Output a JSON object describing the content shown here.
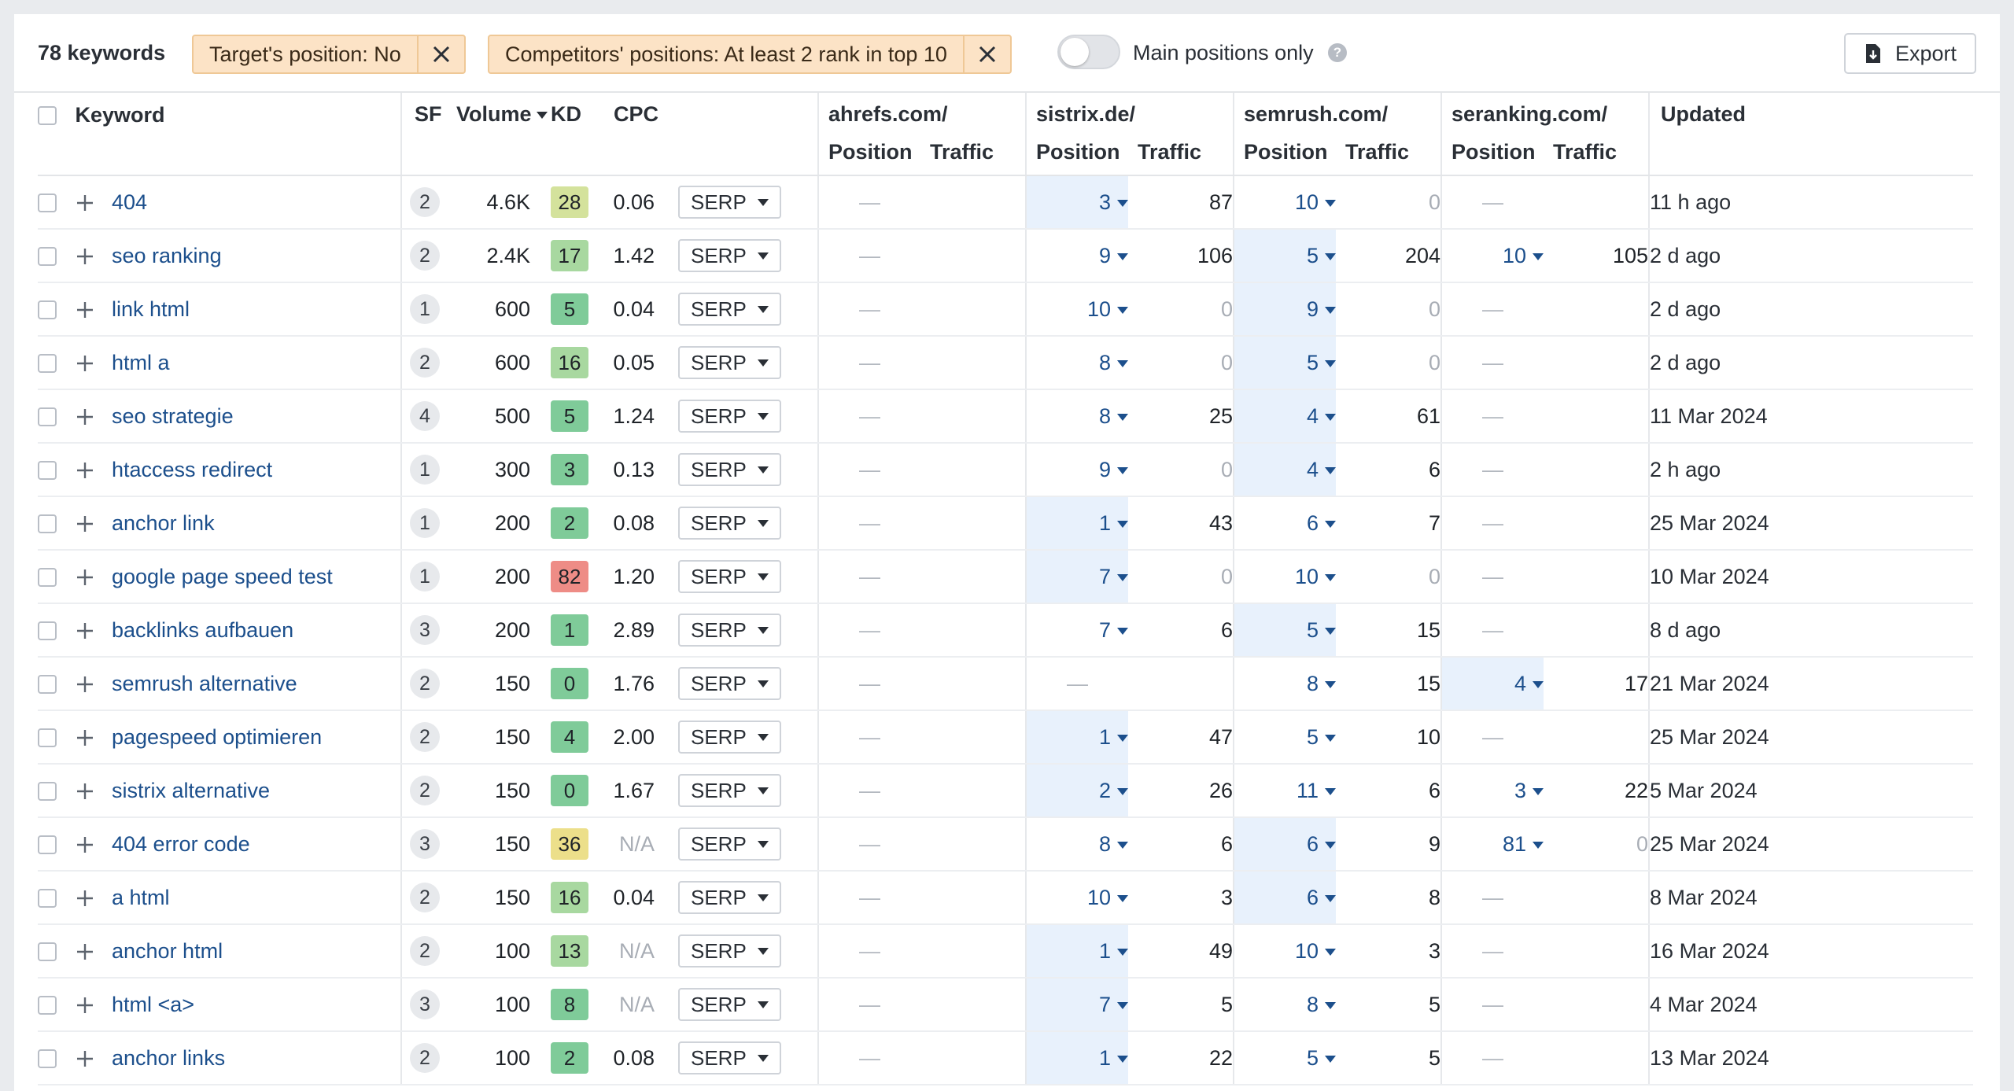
{
  "filters": {
    "keyword_count": "78 keywords",
    "chips": [
      {
        "label": "Target's position: No"
      },
      {
        "label": "Competitors' positions: At least 2 rank in top 10"
      }
    ],
    "toggle_label": "Main positions only",
    "toggle_on": false,
    "help_glyph": "?",
    "export_label": "Export"
  },
  "table": {
    "headers": {
      "keyword": "Keyword",
      "sf": "SF",
      "volume": "Volume",
      "kd": "KD",
      "cpc": "CPC",
      "updated": "Updated",
      "position": "Position",
      "traffic": "Traffic"
    },
    "competitors": [
      "ahrefs.com/",
      "sistrix.de/",
      "semrush.com/",
      "seranking.com/"
    ],
    "serp_label": "SERP",
    "dash": "—",
    "colors": {
      "kd_green_dark": "#7fcb99",
      "kd_green_mid": "#a8d8a0",
      "kd_yellow_green": "#d4e29c",
      "kd_yellow": "#ecdf8a",
      "kd_red": "#ee8c86",
      "highlight": "#e8f1fc",
      "link": "#1c4f8c"
    },
    "rows": [
      {
        "keyword": "404",
        "sf": "2",
        "volume": "4.6K",
        "kd": "28",
        "kd_color": "#d4e29c",
        "cpc": "0.06",
        "c": [
          {
            "p": "—",
            "t": ""
          },
          {
            "p": "3",
            "t": "87",
            "hl": true
          },
          {
            "p": "10",
            "t": "0"
          },
          {
            "p": "—",
            "t": ""
          }
        ],
        "updated": "11 h ago"
      },
      {
        "keyword": "seo ranking",
        "sf": "2",
        "volume": "2.4K",
        "kd": "17",
        "kd_color": "#a8d8a0",
        "cpc": "1.42",
        "c": [
          {
            "p": "—",
            "t": ""
          },
          {
            "p": "9",
            "t": "106"
          },
          {
            "p": "5",
            "t": "204",
            "hl": true
          },
          {
            "p": "10",
            "t": "105"
          }
        ],
        "updated": "2 d ago"
      },
      {
        "keyword": "link html",
        "sf": "1",
        "volume": "600",
        "kd": "5",
        "kd_color": "#7fcb99",
        "cpc": "0.04",
        "c": [
          {
            "p": "—",
            "t": ""
          },
          {
            "p": "10",
            "t": "0"
          },
          {
            "p": "9",
            "t": "0",
            "hl": true
          },
          {
            "p": "—",
            "t": ""
          }
        ],
        "updated": "2 d ago"
      },
      {
        "keyword": "html a",
        "sf": "2",
        "volume": "600",
        "kd": "16",
        "kd_color": "#a8d8a0",
        "cpc": "0.05",
        "c": [
          {
            "p": "—",
            "t": ""
          },
          {
            "p": "8",
            "t": "0"
          },
          {
            "p": "5",
            "t": "0",
            "hl": true
          },
          {
            "p": "—",
            "t": ""
          }
        ],
        "updated": "2 d ago"
      },
      {
        "keyword": "seo strategie",
        "sf": "4",
        "volume": "500",
        "kd": "5",
        "kd_color": "#7fcb99",
        "cpc": "1.24",
        "c": [
          {
            "p": "—",
            "t": ""
          },
          {
            "p": "8",
            "t": "25"
          },
          {
            "p": "4",
            "t": "61",
            "hl": true
          },
          {
            "p": "—",
            "t": ""
          }
        ],
        "updated": "11 Mar 2024"
      },
      {
        "keyword": "htaccess redirect",
        "sf": "1",
        "volume": "300",
        "kd": "3",
        "kd_color": "#7fcb99",
        "cpc": "0.13",
        "c": [
          {
            "p": "—",
            "t": ""
          },
          {
            "p": "9",
            "t": "0"
          },
          {
            "p": "4",
            "t": "6",
            "hl": true
          },
          {
            "p": "—",
            "t": ""
          }
        ],
        "updated": "2 h ago"
      },
      {
        "keyword": "anchor link",
        "sf": "1",
        "volume": "200",
        "kd": "2",
        "kd_color": "#7fcb99",
        "cpc": "0.08",
        "c": [
          {
            "p": "—",
            "t": ""
          },
          {
            "p": "1",
            "t": "43",
            "hl": true
          },
          {
            "p": "6",
            "t": "7"
          },
          {
            "p": "—",
            "t": ""
          }
        ],
        "updated": "25 Mar 2024"
      },
      {
        "keyword": "google page speed test",
        "sf": "1",
        "volume": "200",
        "kd": "82",
        "kd_color": "#ee8c86",
        "cpc": "1.20",
        "c": [
          {
            "p": "—",
            "t": ""
          },
          {
            "p": "7",
            "t": "0",
            "hl": true
          },
          {
            "p": "10",
            "t": "0"
          },
          {
            "p": "—",
            "t": ""
          }
        ],
        "updated": "10 Mar 2024"
      },
      {
        "keyword": "backlinks aufbauen",
        "sf": "3",
        "volume": "200",
        "kd": "1",
        "kd_color": "#7fcb99",
        "cpc": "2.89",
        "c": [
          {
            "p": "—",
            "t": ""
          },
          {
            "p": "7",
            "t": "6"
          },
          {
            "p": "5",
            "t": "15",
            "hl": true
          },
          {
            "p": "—",
            "t": ""
          }
        ],
        "updated": "8 d ago"
      },
      {
        "keyword": "semrush alternative",
        "sf": "2",
        "volume": "150",
        "kd": "0",
        "kd_color": "#7fcb99",
        "cpc": "1.76",
        "c": [
          {
            "p": "—",
            "t": ""
          },
          {
            "p": "—",
            "t": ""
          },
          {
            "p": "8",
            "t": "15"
          },
          {
            "p": "4",
            "t": "17",
            "hl": true
          }
        ],
        "updated": "21 Mar 2024"
      },
      {
        "keyword": "pagespeed optimieren",
        "sf": "2",
        "volume": "150",
        "kd": "4",
        "kd_color": "#7fcb99",
        "cpc": "2.00",
        "c": [
          {
            "p": "—",
            "t": ""
          },
          {
            "p": "1",
            "t": "47",
            "hl": true
          },
          {
            "p": "5",
            "t": "10"
          },
          {
            "p": "—",
            "t": ""
          }
        ],
        "updated": "25 Mar 2024"
      },
      {
        "keyword": "sistrix alternative",
        "sf": "2",
        "volume": "150",
        "kd": "0",
        "kd_color": "#7fcb99",
        "cpc": "1.67",
        "c": [
          {
            "p": "—",
            "t": ""
          },
          {
            "p": "2",
            "t": "26",
            "hl": true
          },
          {
            "p": "11",
            "t": "6"
          },
          {
            "p": "3",
            "t": "22"
          }
        ],
        "updated": "5 Mar 2024"
      },
      {
        "keyword": "404 error code",
        "sf": "3",
        "volume": "150",
        "kd": "36",
        "kd_color": "#ecdf8a",
        "cpc": "N/A",
        "c": [
          {
            "p": "—",
            "t": ""
          },
          {
            "p": "8",
            "t": "6"
          },
          {
            "p": "6",
            "t": "9",
            "hl": true
          },
          {
            "p": "81",
            "t": "0"
          }
        ],
        "updated": "25 Mar 2024"
      },
      {
        "keyword": "a html",
        "sf": "2",
        "volume": "150",
        "kd": "16",
        "kd_color": "#a8d8a0",
        "cpc": "0.04",
        "c": [
          {
            "p": "—",
            "t": ""
          },
          {
            "p": "10",
            "t": "3"
          },
          {
            "p": "6",
            "t": "8",
            "hl": true
          },
          {
            "p": "—",
            "t": ""
          }
        ],
        "updated": "8 Mar 2024"
      },
      {
        "keyword": "anchor html",
        "sf": "2",
        "volume": "100",
        "kd": "13",
        "kd_color": "#a8d8a0",
        "cpc": "N/A",
        "c": [
          {
            "p": "—",
            "t": ""
          },
          {
            "p": "1",
            "t": "49",
            "hl": true
          },
          {
            "p": "10",
            "t": "3"
          },
          {
            "p": "—",
            "t": ""
          }
        ],
        "updated": "16 Mar 2024"
      },
      {
        "keyword": "html <a>",
        "sf": "3",
        "volume": "100",
        "kd": "8",
        "kd_color": "#7fcb99",
        "cpc": "N/A",
        "c": [
          {
            "p": "—",
            "t": ""
          },
          {
            "p": "7",
            "t": "5",
            "hl": true
          },
          {
            "p": "8",
            "t": "5"
          },
          {
            "p": "—",
            "t": ""
          }
        ],
        "updated": "4 Mar 2024"
      },
      {
        "keyword": "anchor links",
        "sf": "2",
        "volume": "100",
        "kd": "2",
        "kd_color": "#7fcb99",
        "cpc": "0.08",
        "c": [
          {
            "p": "—",
            "t": ""
          },
          {
            "p": "1",
            "t": "22",
            "hl": true
          },
          {
            "p": "5",
            "t": "5"
          },
          {
            "p": "—",
            "t": ""
          }
        ],
        "updated": "13 Mar 2024"
      }
    ]
  }
}
